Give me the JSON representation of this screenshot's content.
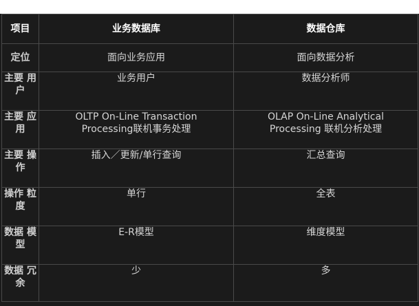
{
  "table": {
    "headers": [
      "项目",
      "业务数据库",
      "数据仓库"
    ],
    "rows": [
      {
        "label_lines": [
          "定位"
        ],
        "business_lines": [
          "面向业务应用"
        ],
        "warehouse_lines": [
          "面向数据分析"
        ]
      },
      {
        "label_lines": [
          "主要",
          "用户"
        ],
        "business_lines": [
          "业务用户"
        ],
        "warehouse_lines": [
          "数据分析师"
        ]
      },
      {
        "label_lines": [
          "主要",
          "应用"
        ],
        "business_lines": [
          "OLTP On-Line Transaction",
          "Processing联机事务处理"
        ],
        "warehouse_lines": [
          "OLAP On-Line Analytical",
          "Processing 联机分析处理"
        ]
      },
      {
        "label_lines": [
          "主要",
          "操作"
        ],
        "business_lines": [
          "插入／更新/单行查询"
        ],
        "warehouse_lines": [
          "汇总查询"
        ]
      },
      {
        "label_lines": [
          "操作",
          "粒度"
        ],
        "business_lines": [
          "单行"
        ],
        "warehouse_lines": [
          "全表"
        ]
      },
      {
        "label_lines": [
          "数据",
          "模型"
        ],
        "business_lines": [
          "E-R模型"
        ],
        "warehouse_lines": [
          "维度模型"
        ]
      },
      {
        "label_lines": [
          "数据",
          "冗余"
        ],
        "business_lines": [
          "少"
        ],
        "warehouse_lines": [
          "多"
        ]
      }
    ]
  }
}
